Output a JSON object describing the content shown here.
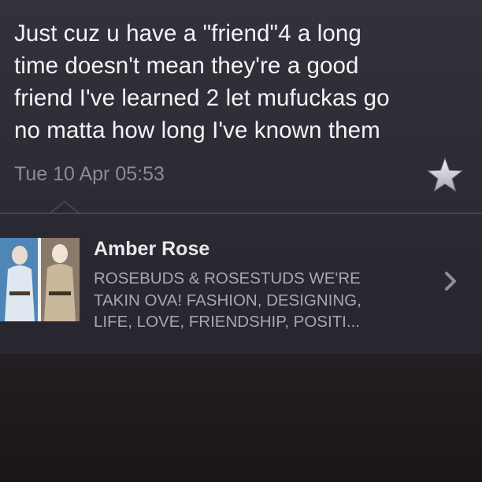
{
  "tweet": {
    "text": "Just cuz u have a \"friend\"4 a long\ntime doesn't mean they're a good\nfriend I've learned 2 let mufuckas go\nno matta how long I've known them",
    "timestamp": "Tue 10 Apr 05:53",
    "favorite_icon": "star-icon"
  },
  "profile": {
    "name": "Amber Rose",
    "bio": "ROSEBUDS & ROSESTUDS WE'RE\nTAKIN OVA! FASHION, DESIGNING,\nLIFE, LOVE, FRIENDSHIP, POSITI...",
    "disclosure_icon": "chevron-right-icon",
    "avatar_icon": "avatar"
  },
  "colors": {
    "background": "#2b2a33",
    "text_primary": "#f4f4f6",
    "text_secondary": "#8d8c96",
    "bio_text": "#a8a7b0"
  }
}
